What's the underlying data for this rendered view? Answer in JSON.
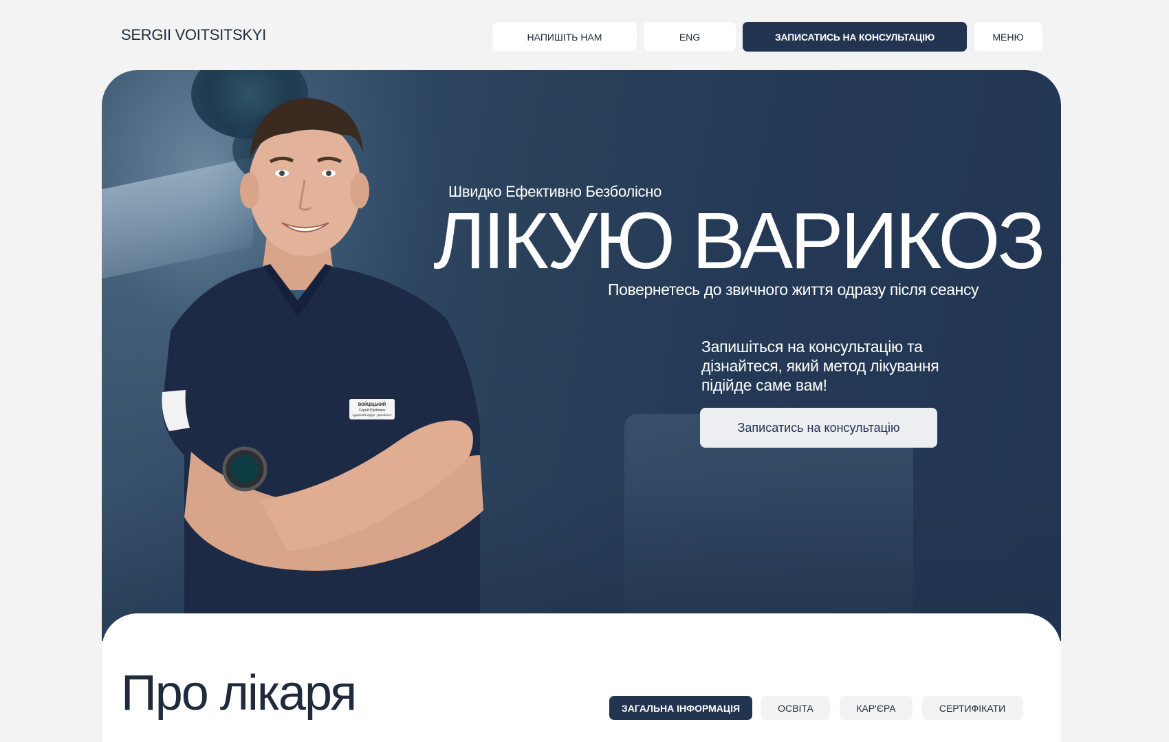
{
  "header": {
    "logo": "SERGII VOITSITSKYI",
    "nav": {
      "write_us": "НАПИШІТЬ НАМ",
      "language": "ENG",
      "book": "ЗАПИСАТИСЬ НА КОНСУЛЬТАЦІЮ",
      "menu": "МЕНЮ"
    }
  },
  "hero": {
    "tagline": "Швидко Ефективно Безболісно",
    "title": "ЛІКУЮ ВАРИКОЗ",
    "subtitle": "Повернетесь до звичного життя одразу після сеансу",
    "cta_text": "Запишіться на консультацію та дізнайтеся, який метод лікування підійде саме вам!",
    "cta_button": "Записатись на консультацію",
    "badge_name": "ВОЙЦІЦЬКИЙ",
    "badge_line2": "Сергій Юрійович",
    "badge_line3": "судинний хірург , флеболог"
  },
  "about": {
    "title": "Про лікаря",
    "tabs": [
      {
        "label": "ЗАГАЛЬНА ІНФОРМАЦІЯ",
        "active": true
      },
      {
        "label": "ОСВІТА",
        "active": false
      },
      {
        "label": "КАР'ЄРА",
        "active": false
      },
      {
        "label": "СЕРТИФІКАТИ",
        "active": false
      }
    ]
  },
  "colors": {
    "primary": "#22344f",
    "background": "#f3f3f3",
    "white": "#ffffff"
  }
}
